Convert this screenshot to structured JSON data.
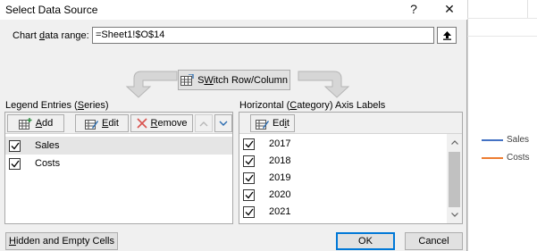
{
  "dialog": {
    "title": "Select Data Source",
    "help_label": "?",
    "close_label": "✕"
  },
  "range": {
    "label_pre": "Chart ",
    "label_key": "d",
    "label_post": "ata range:",
    "value": "=Sheet1!$O$14"
  },
  "switch_btn": {
    "label_key": "W",
    "label_pre": "S",
    "label_post": "itch Row/Column"
  },
  "legend": {
    "label_pre": "Legend Entries (",
    "label_key": "S",
    "label_post": "eries)",
    "add_key": "A",
    "add_rest": "dd",
    "edit_key": "E",
    "edit_rest": "dit",
    "remove_key": "R",
    "remove_rest": "emove",
    "items": [
      {
        "label": "Sales",
        "checked": true,
        "selected": true
      },
      {
        "label": "Costs",
        "checked": true,
        "selected": false
      }
    ]
  },
  "axis": {
    "label_pre": "Horizontal (",
    "label_key": "C",
    "label_post": "ategory) Axis Labels",
    "edit_pre": "Ed",
    "edit_key": "i",
    "edit_post": "t",
    "items": [
      {
        "label": "2017",
        "checked": true
      },
      {
        "label": "2018",
        "checked": true
      },
      {
        "label": "2019",
        "checked": true
      },
      {
        "label": "2020",
        "checked": true
      },
      {
        "label": "2021",
        "checked": true
      }
    ]
  },
  "footer": {
    "hidden_key": "H",
    "hidden_rest": "idden and Empty Cells",
    "ok_label": "OK",
    "cancel_label": "Cancel"
  },
  "chart_legend": {
    "items": [
      {
        "label": "Sales",
        "color": "#4472c4"
      },
      {
        "label": "Costs",
        "color": "#ed7d31"
      }
    ]
  }
}
